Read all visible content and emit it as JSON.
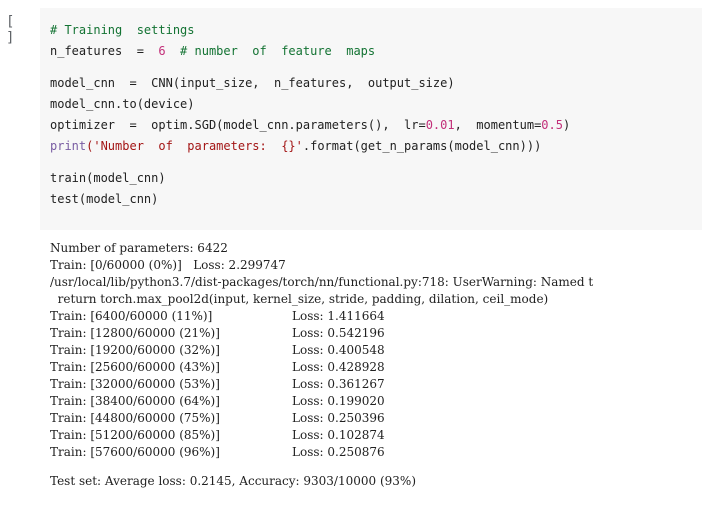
{
  "cell": {
    "run_button_label": "[ ]",
    "code_lines": [
      [
        {
          "t": "# Training  settings",
          "c": "comment"
        }
      ],
      [
        {
          "t": "n_features  =  ",
          "c": "default"
        },
        {
          "t": "6",
          "c": "number"
        },
        {
          "t": "  # number  of  feature  maps",
          "c": "comment"
        }
      ],
      [],
      [
        {
          "t": "model_cnn  =  CNN(input_size,  n_features,  output_size)",
          "c": "default"
        }
      ],
      [
        {
          "t": "model_cnn.to(device)",
          "c": "default"
        }
      ],
      [
        {
          "t": "optimizer  =  optim.SGD(model_cnn.parameters(),  lr=",
          "c": "default"
        },
        {
          "t": "0.01",
          "c": "number"
        },
        {
          "t": ",  momentum=",
          "c": "default"
        },
        {
          "t": "0.5",
          "c": "number"
        },
        {
          "t": ")",
          "c": "default"
        }
      ],
      [
        {
          "t": "print",
          "c": "builtin"
        },
        {
          "t": "('Number  of  parameters:  {}'",
          "c": "string"
        },
        {
          "t": ".format(get_n_params(model_cnn)))",
          "c": "default"
        }
      ],
      [],
      [
        {
          "t": "train(model_cnn)",
          "c": "default"
        }
      ],
      [
        {
          "t": "test(model_cnn)",
          "c": "default"
        }
      ]
    ]
  },
  "output": {
    "lines": [
      {
        "type": "text",
        "text": "Number of parameters: 6422"
      },
      {
        "type": "text",
        "text": "Train: [0/60000 (0%)]   Loss: 2.299747"
      },
      {
        "type": "text",
        "text": "/usr/local/lib/python3.7/dist-packages/torch/nn/functional.py:718: UserWarning: Named t"
      },
      {
        "type": "text",
        "text": "  return torch.max_pool2d(input, kernel_size, stride, padding, dilation, ceil_mode)"
      },
      {
        "type": "train",
        "left": "Train: [6400/60000 (11%)]",
        "right": "Loss: 1.411664"
      },
      {
        "type": "train",
        "left": "Train: [12800/60000 (21%)]",
        "right": "Loss: 0.542196"
      },
      {
        "type": "train",
        "left": "Train: [19200/60000 (32%)]",
        "right": "Loss: 0.400548"
      },
      {
        "type": "train",
        "left": "Train: [25600/60000 (43%)]",
        "right": "Loss: 0.428928"
      },
      {
        "type": "train",
        "left": "Train: [32000/60000 (53%)]",
        "right": "Loss: 0.361267"
      },
      {
        "type": "train",
        "left": "Train: [38400/60000 (64%)]",
        "right": "Loss: 0.199020"
      },
      {
        "type": "train",
        "left": "Train: [44800/60000 (75%)]",
        "right": "Loss: 0.250396"
      },
      {
        "type": "train",
        "left": "Train: [51200/60000 (85%)]",
        "right": "Loss: 0.102874"
      },
      {
        "type": "train",
        "left": "Train: [57600/60000 (96%)]",
        "right": "Loss: 0.250876"
      },
      {
        "type": "blank"
      },
      {
        "type": "text",
        "text": "Test set: Average loss: 0.2145, Accuracy: 9303/10000 (93%)"
      }
    ]
  },
  "colors": {
    "code_background": "#f7f7f7",
    "comment": "#137333",
    "number": "#c22f79",
    "builtin": "#795da3",
    "string": "#a31515",
    "default": "#212121"
  },
  "icons": {
    "run_button": "run-cell-icon"
  }
}
